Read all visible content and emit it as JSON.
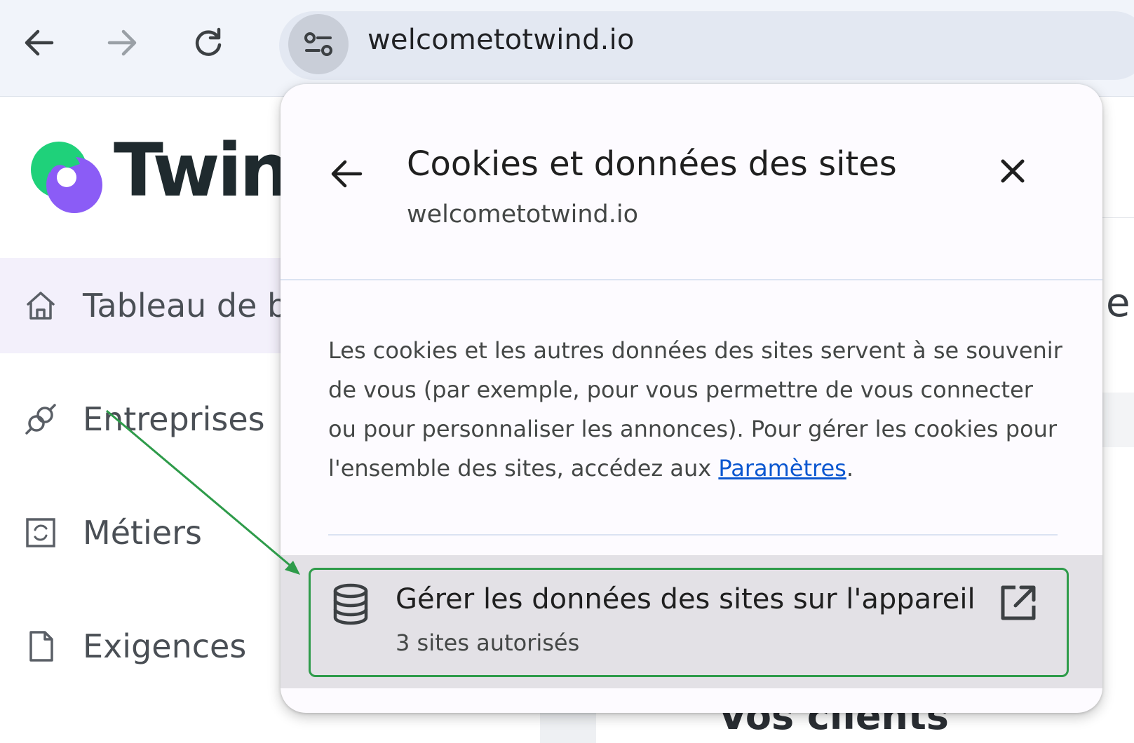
{
  "browser": {
    "url": "welcometotwind.io",
    "icons": {
      "back": "arrow-left-icon",
      "forward": "arrow-right-icon",
      "reload": "reload-icon",
      "site_info": "tune-icon"
    }
  },
  "app": {
    "logo_text": "Twind",
    "sidebar": {
      "items": [
        {
          "label": "Tableau de bord",
          "icon": "home-icon",
          "active": true
        },
        {
          "label": "Entreprises",
          "icon": "link-icon",
          "active": false
        },
        {
          "label": "Métiers",
          "icon": "refresh-square-icon",
          "active": false
        },
        {
          "label": "Exigences",
          "icon": "document-icon",
          "active": false
        }
      ]
    },
    "right_edge_char": "e",
    "bottom_heading": "Vos clients"
  },
  "popup": {
    "title": "Cookies et données des sites",
    "subtitle": "welcometotwind.io",
    "description_before_link": "Les cookies et les autres données des sites servent à se souvenir de vous (par exemple, pour vous permettre de vous connecter ou pour personnaliser les annonces). Pour gérer les cookies pour l'ensemble des sites, accédez aux ",
    "link_label": "Paramètres",
    "description_after_link": ".",
    "manage_row": {
      "title": "Gérer les données des sites sur l'appareil",
      "subtitle": "3 sites autorisés",
      "icon": "database-icon",
      "trailing_icon": "open-in-new-icon"
    }
  },
  "colors": {
    "highlight": "#2e9b4a",
    "link": "#0b57d0",
    "logo_green": "#1fd17a",
    "logo_purple": "#8b5cf6",
    "sidebar_active_bg": "#f3f0fb"
  }
}
